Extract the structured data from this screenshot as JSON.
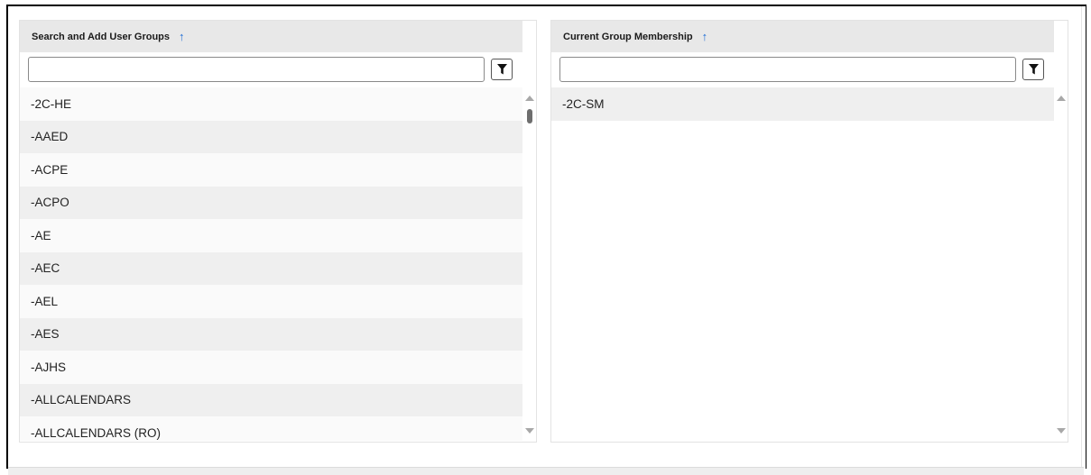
{
  "left_panel": {
    "title": "Search and Add User Groups",
    "sort_icon": "arrow-up-icon",
    "search_value": "",
    "filter_icon": "filter-icon",
    "items": [
      "-2C-HE",
      "-AAED",
      "-ACPE",
      "-ACPO",
      "-AE",
      "-AEC",
      "-AEL",
      "-AES",
      "-AJHS",
      "-ALLCALENDARS",
      "-ALLCALENDARS (RO)"
    ]
  },
  "right_panel": {
    "title": "Current Group Membership",
    "sort_icon": "arrow-up-icon",
    "search_value": "",
    "filter_icon": "filter-icon",
    "items": [
      "-2C-SM"
    ]
  },
  "colors": {
    "header_bg": "#e8e8e8",
    "sort_arrow": "#1f6dd6",
    "row_alt": "#efefef"
  }
}
